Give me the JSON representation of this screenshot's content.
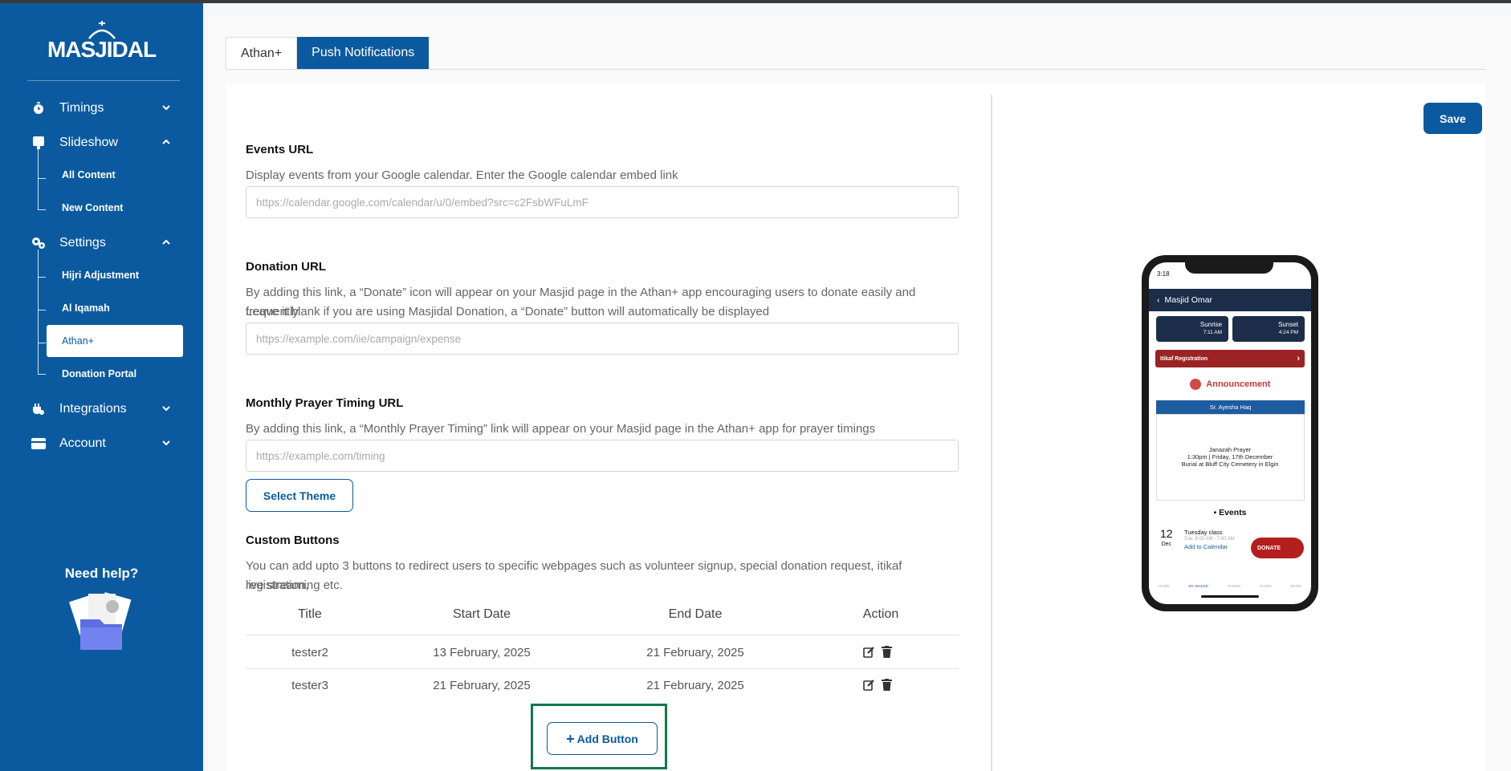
{
  "brand": {
    "logo_text": "MASJIDAL"
  },
  "sidebar": {
    "items": [
      {
        "label": "Timings",
        "icon": "timer-icon",
        "expanded": false
      },
      {
        "label": "Slideshow",
        "icon": "slideshow-icon",
        "expanded": true,
        "children": [
          "All Content",
          "New Content"
        ]
      },
      {
        "label": "Settings",
        "icon": "settings-gears-icon",
        "expanded": true,
        "children": [
          "Hijri Adjustment",
          "Al Iqamah",
          "Athan+",
          "Donation Portal"
        ],
        "active_child": "Athan+"
      },
      {
        "label": "Integrations",
        "icon": "integrations-icon",
        "expanded": false
      },
      {
        "label": "Account",
        "icon": "credit-card-icon",
        "expanded": false
      }
    ],
    "help": {
      "title": "Need help?"
    }
  },
  "tabs": [
    {
      "label": "Athan+",
      "active": false
    },
    {
      "label": "Push Notifications",
      "active": true
    }
  ],
  "form": {
    "events": {
      "label": "Events URL",
      "description": "Display events from your Google calendar. Enter the Google calendar embed link",
      "placeholder": "https://calendar.google.com/calendar/u/0/embed?src=c2FsbWFuLmF"
    },
    "donation": {
      "label": "Donation URL",
      "description_1": "By adding this link, a “Donate” icon will appear on your Masjid page in the Athan+ app encouraging users to donate easily and frequently.",
      "description_2": "Leave it blank if you are using Masjidal Donation, a “Donate” button will automatically be displayed",
      "placeholder": "https://example.com/iie/campaign/expense"
    },
    "monthly": {
      "label": "Monthly Prayer Timing URL",
      "description": "By adding this link, a “Monthly Prayer Timing” link will appear on your Masjid page in the Athan+ app for prayer timings",
      "placeholder": "https://example.com/timing"
    },
    "select_theme_label": "Select Theme",
    "custom_buttons": {
      "label": "Custom Buttons",
      "description_1": "You can add upto 3 buttons to redirect users to specific webpages such as volunteer signup, special donation request, itikaf registration,",
      "description_2": "live streaming etc.",
      "columns": [
        "Title",
        "Start Date",
        "End Date",
        "Action"
      ],
      "rows": [
        {
          "title": "tester2",
          "start": "13 February, 2025",
          "end": "21 February, 2025"
        },
        {
          "title": "tester3",
          "start": "21 February, 2025",
          "end": "21 February, 2025"
        }
      ],
      "add_label": "Add Button"
    },
    "save_label": "Save"
  },
  "phone": {
    "time": "3:18",
    "masjid_name": "Masjid Omar",
    "sunrise": {
      "label": "Sunrise",
      "time": "7:11 AM"
    },
    "sunset": {
      "label": "Sunset",
      "time": "4:24 PM"
    },
    "itikaf": "Itikaf Registration",
    "announcement": "Announcement",
    "announcer": "Sr. Ayesha Haq",
    "janazah_1": "Janazah Prayer",
    "janazah_2": "1:30pm | Friday, 17th December",
    "janazah_3": "Burial at Bluff City Cemetery in Elgin",
    "events_title": "Events",
    "event_day": "12",
    "event_month": "Dec",
    "event_name": "Tuesday class",
    "event_time": "Tue, 8:00 AM - 7:00 AM",
    "event_add": "Add to Calendar",
    "donate": "DONATE",
    "nav": [
      "HOME",
      "MY MASJID",
      "THIKRS",
      "RADIO",
      "MORE"
    ]
  }
}
